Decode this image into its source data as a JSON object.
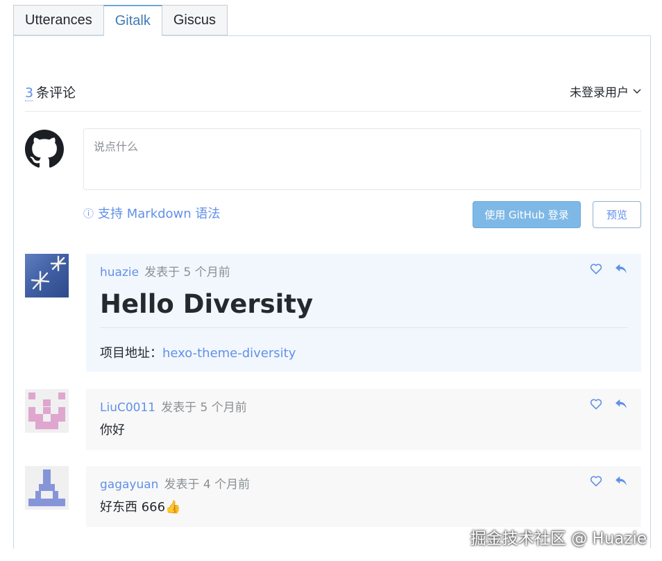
{
  "tabs": [
    {
      "label": "Utterances",
      "active": false
    },
    {
      "label": "Gitalk",
      "active": true
    },
    {
      "label": "Giscus",
      "active": false
    }
  ],
  "comment_count": {
    "number": "3",
    "label": "条评论"
  },
  "user_menu": {
    "label": "未登录用户"
  },
  "editor": {
    "placeholder": "说点什么"
  },
  "markdown_hint": {
    "icon": "ⓘ",
    "label": "支持 Markdown 语法"
  },
  "buttons": {
    "login": "使用 GitHub 登录",
    "preview": "预览"
  },
  "comments": [
    {
      "user": "huazie",
      "meta": "发表于 5 个月前",
      "heading": "Hello Diversity",
      "body_prefix": "项目地址：",
      "link_text": "hexo-theme-diversity"
    },
    {
      "user": "LiuC0011",
      "meta": "发表于 5 个月前",
      "body": "你好"
    },
    {
      "user": "gagayuan",
      "meta": "发表于 4 个月前",
      "body": "好东西 666👍"
    }
  ],
  "watermark": "掘金技术社区 @ Huazie",
  "colors": {
    "accent": "#6190e8",
    "tab_active": "#3f7ab3",
    "login_button": "#7eb8e6"
  }
}
